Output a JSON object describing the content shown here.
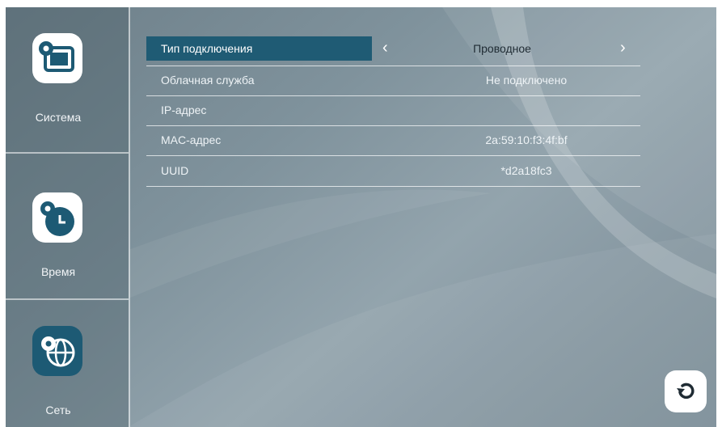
{
  "sidebar": {
    "items": [
      {
        "label": "Система",
        "icon": "settings-screen-icon"
      },
      {
        "label": "Время",
        "icon": "time-settings-icon"
      },
      {
        "label": "Сеть",
        "icon": "network-settings-icon"
      }
    ],
    "active_index": 2
  },
  "settings": {
    "header": {
      "label": "Тип подключения",
      "value": "Проводное"
    },
    "rows": [
      {
        "label": "Облачная служба",
        "value": "Не подключено"
      },
      {
        "label": "IP-адрес",
        "value": ""
      },
      {
        "label": "MAC-адрес",
        "value": "2a:59:10:f3:4f:bf"
      },
      {
        "label": "UUID",
        "value": "*d2a18fc3"
      }
    ]
  },
  "colors": {
    "accent": "#1f5b74",
    "background": "#7f929c"
  },
  "icons": {
    "prev": "chevron-left-icon",
    "next": "chevron-right-icon",
    "refresh": "refresh-icon"
  }
}
